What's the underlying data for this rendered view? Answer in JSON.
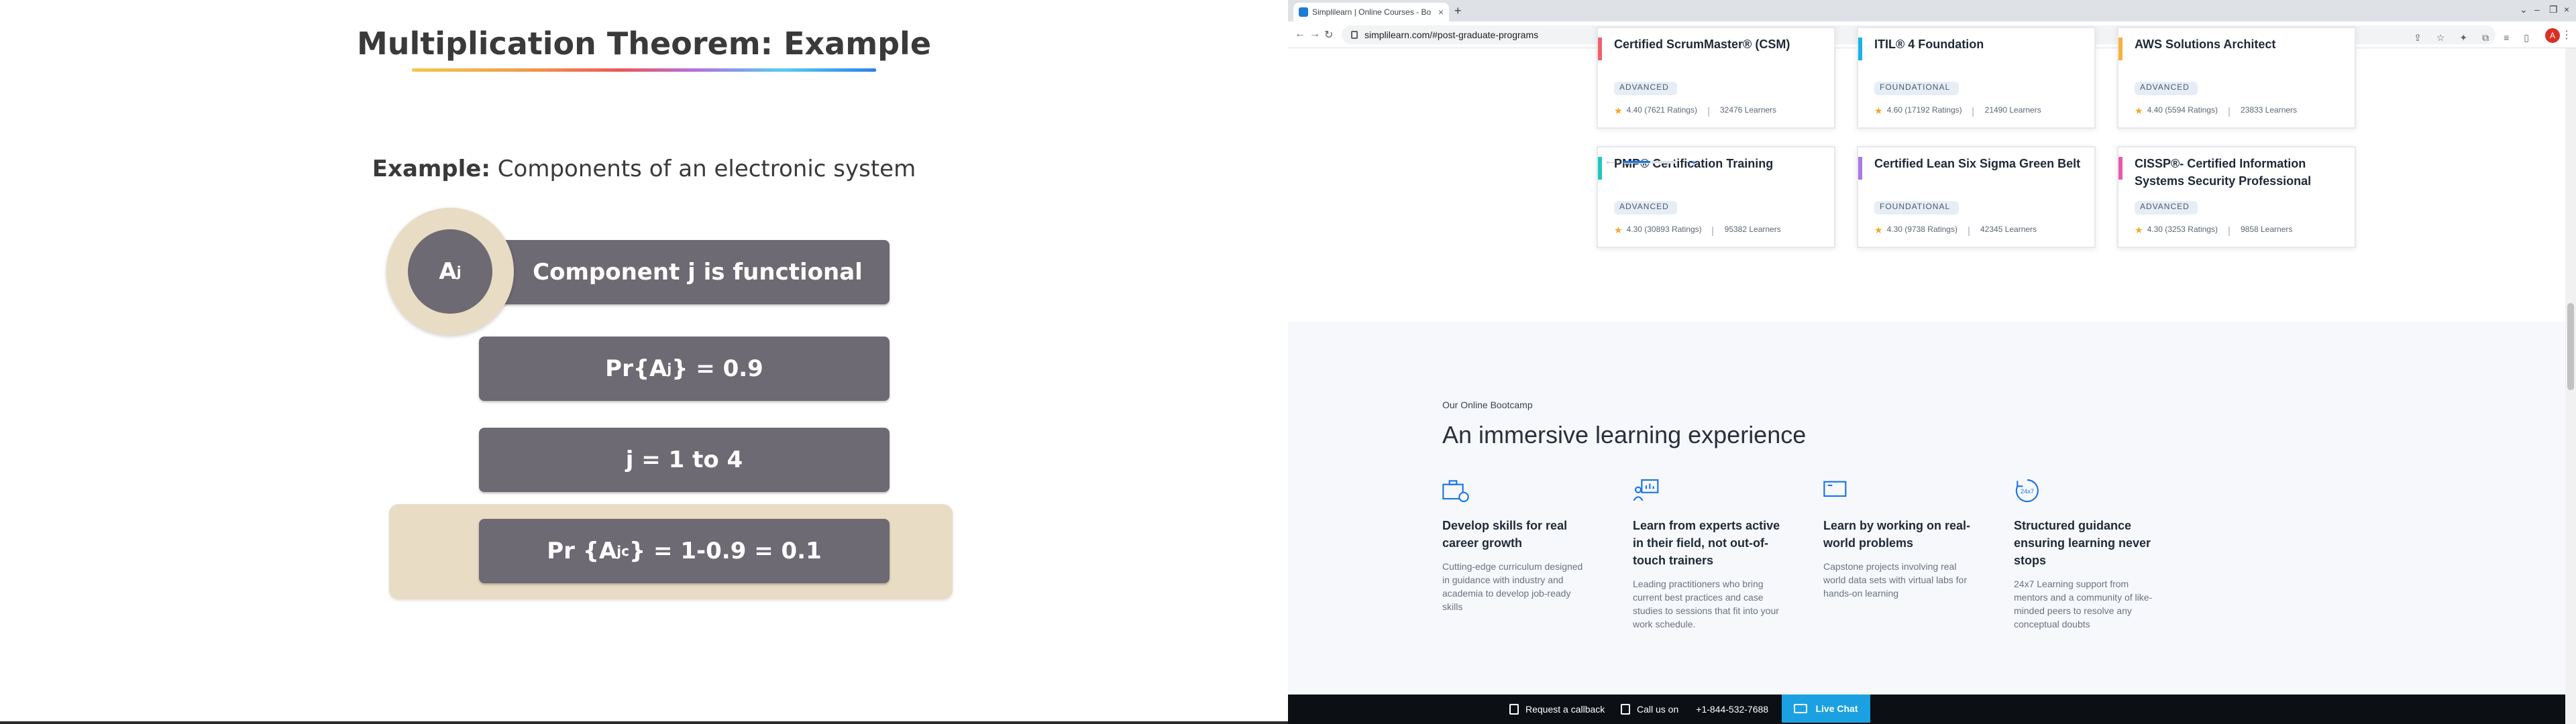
{
  "slide": {
    "title": "Multiplication Theorem: Example",
    "example_label": "Example:",
    "example_text": " Components of an electronic system",
    "circle_base": "A",
    "circle_sub": "j",
    "box1_text": "Component j is functional",
    "box2_pre": "Pr{A",
    "box2_sub": "j",
    "box2_post": " } = 0.9",
    "box3_text": "j = 1 to 4",
    "box4_pre": "Pr {A",
    "box4_sub": "j",
    "box4_sup": "c",
    "box4_post": "} = 1-0.9 = 0.1"
  },
  "browser": {
    "tab_title": "Simplilearn | Online Courses - Bo",
    "url": "simplilearn.com/#post-graduate-programs",
    "profile_initial": "A"
  },
  "courses": [
    {
      "title": "Certified ScrumMaster® (CSM)",
      "level": "ADVANCED",
      "rating": "4.40 (7621 Ratings)",
      "learners": "32476 Learners",
      "accent": "#f0616b"
    },
    {
      "title": "ITIL® 4 Foundation",
      "level": "FOUNDATIONAL",
      "rating": "4.60 (17192 Ratings)",
      "learners": "21490 Learners",
      "accent": "#1ab1e8"
    },
    {
      "title": "AWS Solutions Architect",
      "level": "ADVANCED",
      "rating": "4.40 (5594 Ratings)",
      "learners": "23833 Learners",
      "accent": "#f5b13b"
    },
    {
      "title": "PMP® Certification Training",
      "level": "ADVANCED",
      "rating": "4.30 (30893 Ratings)",
      "learners": "95382 Learners",
      "accent": "#1cc9c0"
    },
    {
      "title": "Certified Lean Six Sigma Green Belt",
      "level": "FOUNDATIONAL",
      "rating": "4.30 (9738 Ratings)",
      "learners": "42345 Learners",
      "accent": "#a77be4"
    },
    {
      "title": "CISSP®- Certified Information Systems Security Professional",
      "level": "ADVANCED",
      "rating": "4.30 (3253 Ratings)",
      "learners": "9858 Learners",
      "accent": "#e85aa8"
    }
  ],
  "bootcamp": {
    "eyebrow": "Our Online Bootcamp",
    "heading": "An immersive learning experience",
    "features": [
      {
        "icon": "briefcase-icon",
        "title": "Develop skills for real career growth",
        "desc": "Cutting-edge curriculum designed in guidance with industry and academia to develop job-ready skills"
      },
      {
        "icon": "trainer-board-icon",
        "title": "Learn from experts active in their field, not out-of-touch trainers",
        "desc": "Leading practitioners who bring current best practices and case studies to sessions that fit into your work schedule."
      },
      {
        "icon": "monitor-icon",
        "title": "Learn by working on real-world problems",
        "desc": "Capstone projects involving real world data sets with virtual labs for hands-on learning"
      },
      {
        "icon": "clock-24x7-icon",
        "title": "Structured guidance ensuring learning never stops",
        "desc": "24x7 Learning support from mentors and a community of like-minded peers to resolve any conceptual doubts"
      }
    ],
    "icon_24x7": "24x7"
  },
  "bottom_bar": {
    "callback": "Request a callback",
    "call_us": "Call us on",
    "phone": "+1-844-532-7688",
    "live_chat": "Live Chat"
  },
  "carousel": {
    "progress": 0.5
  },
  "colors": {
    "slide_box": "#6e6a73",
    "slide_band": "#e8dcc4",
    "brand_blue": "#1a73e8",
    "live_chat": "#1ba1e2"
  }
}
